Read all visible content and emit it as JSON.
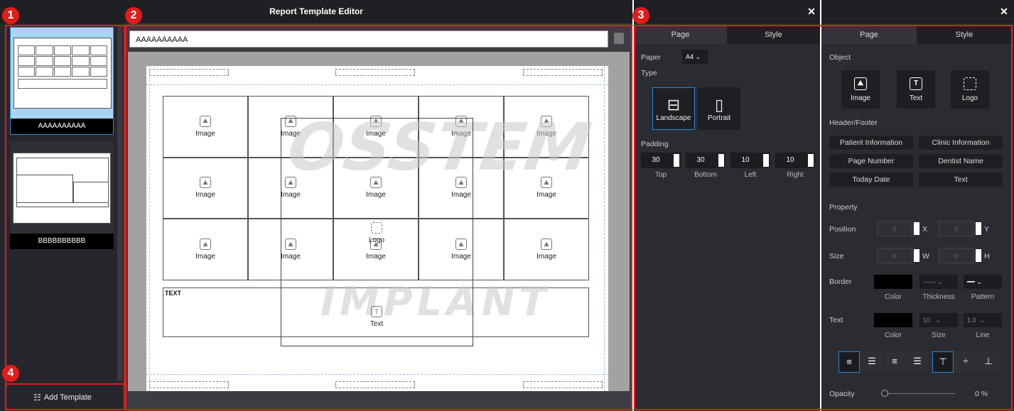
{
  "window": {
    "title": "Report Template Editor",
    "close": "✕",
    "close2": "✕"
  },
  "badges": [
    "1",
    "2",
    "3",
    "4"
  ],
  "left": {
    "templates": [
      {
        "name": "AAAAAAAAAA",
        "selected": true
      },
      {
        "name": "BBBBBBBBBB",
        "selected": false
      }
    ],
    "add_template_label": "Add Template"
  },
  "center": {
    "template_name": "AAAAAAAAAA",
    "cells": [
      "Image",
      "Image",
      "Image",
      "Image",
      "Image",
      "Image",
      "Image",
      "Image",
      "Image",
      "Image",
      "Image",
      "Image",
      "Image",
      "Image",
      "Image"
    ],
    "logo_label": "Logo",
    "text_box_label": "TEXT",
    "text_item_label": "Text",
    "watermark_line1": "OSSTEM",
    "watermark_line2": "IMPLANT"
  },
  "page_panel": {
    "tabs": [
      "Page",
      "Style"
    ],
    "paper_label": "Paper",
    "paper_value": "A4",
    "type_label": "Type",
    "landscape_label": "Landscape",
    "portrait_label": "Portrait",
    "padding_label": "Padding",
    "padding": [
      {
        "value": "30",
        "label": "Top"
      },
      {
        "value": "30",
        "label": "Bottom"
      },
      {
        "value": "10",
        "label": "Left"
      },
      {
        "value": "10",
        "label": "Right"
      }
    ]
  },
  "style_panel": {
    "tabs": [
      "Page",
      "Style"
    ],
    "object_label": "Object",
    "objects": [
      "Image",
      "Text",
      "Logo"
    ],
    "header_footer_label": "Header/Footer",
    "hf_buttons": [
      "Patient Information",
      "Clinic Information",
      "Page Number",
      "Dentist Name",
      "Today Date",
      "Text"
    ],
    "property_label": "Property",
    "position_label": "Position",
    "pos_x": "0",
    "pos_x_label": "X",
    "pos_y": "0",
    "pos_y_label": "Y",
    "size_label": "Size",
    "size_w": "0",
    "size_w_label": "W",
    "size_h": "0",
    "size_h_label": "H",
    "border_label": "Border",
    "border_sub": [
      "Color",
      "Thickness",
      "Pattern"
    ],
    "text_label": "Text",
    "text_sub": [
      "Color",
      "Size",
      "Line"
    ],
    "text_size": "10",
    "text_line": "1.0",
    "opacity_label": "Opacity",
    "opacity_value": "0 %",
    "opacity_fraction": 0
  }
}
